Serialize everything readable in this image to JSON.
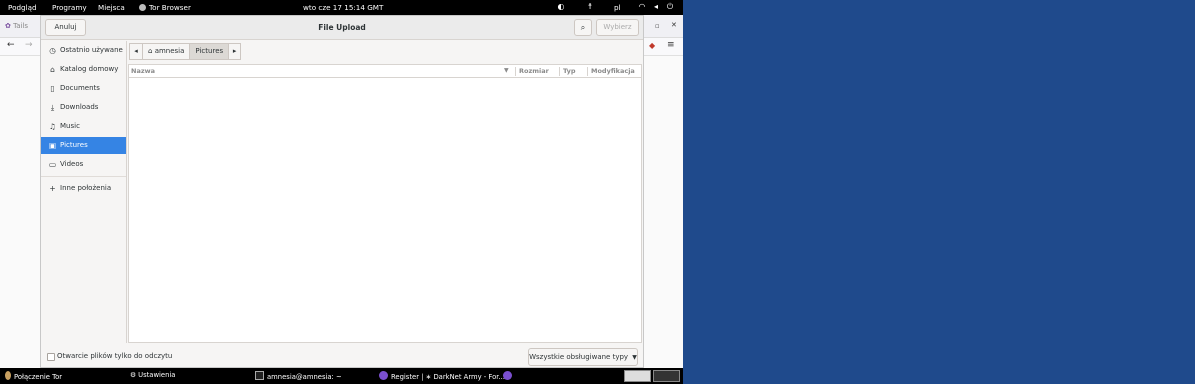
{
  "top_panel": {
    "menus": [
      "Podgląd",
      "Programy",
      "Miejsca",
      "Tor Browser"
    ],
    "clock": "wto cze 17  15:14 GMT",
    "lang": "pl"
  },
  "browser": {
    "tab_label": "Tails"
  },
  "dialog": {
    "title": "File Upload",
    "cancel_label": "Anuluj",
    "select_label": "Wybierz",
    "sidebar": [
      {
        "label": "Ostatnio używane",
        "icon": "clock-icon"
      },
      {
        "label": "Katalog domowy",
        "icon": "home-icon"
      },
      {
        "label": "Documents",
        "icon": "document-icon"
      },
      {
        "label": "Downloads",
        "icon": "download-icon"
      },
      {
        "label": "Music",
        "icon": "music-icon"
      },
      {
        "label": "Pictures",
        "icon": "pictures-icon",
        "active": true
      },
      {
        "label": "Videos",
        "icon": "video-icon"
      },
      {
        "label": "Inne położenia",
        "icon": "plus-icon"
      }
    ],
    "path": [
      "amnesia",
      "Pictures"
    ],
    "columns": [
      "Nazwa",
      "Rozmiar",
      "Typ",
      "Modyfikacja"
    ],
    "readonly_label": "Otwarcie plików tylko do odczytu",
    "filter_label": "Wszystkie obsługiwane typy"
  },
  "taskbar": {
    "items": [
      "Połączenie Tor",
      "Ustawienia",
      "amnesia@amnesia: ~",
      "Register | ∗ DarkNet Army - For..."
    ]
  },
  "colors": {
    "accent": "#3584e4",
    "desktop": "#1f4a8c",
    "panel": "#000000"
  }
}
